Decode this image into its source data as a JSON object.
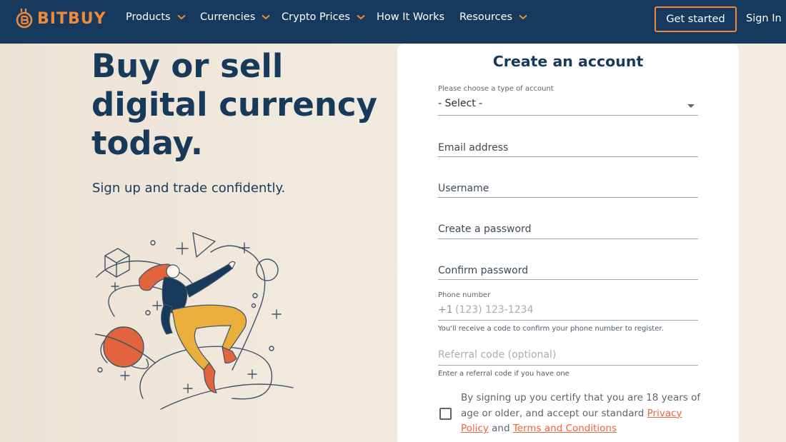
{
  "brand": {
    "name": "BITBUY",
    "accent": "#f08a3a",
    "navy": "#153a5e"
  },
  "nav": {
    "items": [
      {
        "label": "Products",
        "dropdown": true
      },
      {
        "label": "Currencies",
        "dropdown": true
      },
      {
        "label": "Crypto Prices",
        "dropdown": true
      },
      {
        "label": "How It Works",
        "dropdown": false
      },
      {
        "label": "Resources",
        "dropdown": true
      }
    ],
    "cta": "Get started",
    "sign_in": "Sign In"
  },
  "hero": {
    "headline_lines": [
      "Buy or sell",
      "digital currency",
      "today."
    ],
    "subhead": "Sign up and trade confidently.",
    "illustration": "woman-floating-in-space-with-crypto-shapes"
  },
  "form": {
    "title": "Create an account",
    "account_type": {
      "label": "Please choose a type of account",
      "value": "- Select -"
    },
    "email": {
      "placeholder": "Email address"
    },
    "username": {
      "placeholder": "Username"
    },
    "password": {
      "placeholder": "Create a password"
    },
    "confirm_password": {
      "placeholder": "Confirm password"
    },
    "phone": {
      "label": "Phone number",
      "prefix": "+1",
      "placeholder": "(123) 123-1234",
      "hint": "You'll receive a code to confirm your phone number to register."
    },
    "referral": {
      "placeholder": "Referral code (optional)",
      "hint": "Enter a referral code if you have one"
    },
    "consent": {
      "text_before": "By signing up you certify that you are 18 years of age or older, and accept our standard ",
      "privacy_link": "Privacy Policy",
      "and": " and ",
      "terms_link": "Terms and Conditions",
      "checked": false
    }
  }
}
